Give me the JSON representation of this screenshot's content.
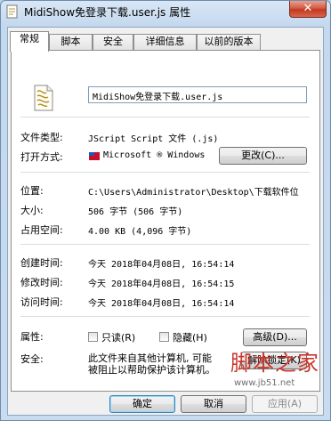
{
  "window": {
    "title": "MidiShow免登录下载.user.js 属性",
    "close_glyph": "✕"
  },
  "tabs": [
    {
      "label": "常规",
      "active": true
    },
    {
      "label": "脚本"
    },
    {
      "label": "安全"
    },
    {
      "label": "详细信息"
    },
    {
      "label": "以前的版本"
    }
  ],
  "general": {
    "filename": "MidiShow免登录下载.user.js",
    "file_type_label": "文件类型:",
    "file_type_value": "JScript Script 文件 (.js)",
    "open_with_label": "打开方式:",
    "open_with_value": "Microsoft ® Windows",
    "change_button": "更改(C)...",
    "location_label": "位置:",
    "location_value": "C:\\Users\\Administrator\\Desktop\\下载软件位",
    "size_label": "大小:",
    "size_value": "506 字节 (506 字节)",
    "size_on_disk_label": "占用空间:",
    "size_on_disk_value": "4.00 KB (4,096 字节)",
    "created_label": "创建时间:",
    "created_value": "今天 2018年04月08日, 16:54:14",
    "modified_label": "修改时间:",
    "modified_value": "今天 2018年04月08日, 16:54:15",
    "accessed_label": "访问时间:",
    "accessed_value": "今天 2018年04月08日, 16:54:14",
    "attributes_label": "属性:",
    "readonly_label": "只读(R)",
    "hidden_label": "隐藏(H)",
    "advanced_button": "高级(D)...",
    "security_label": "安全:",
    "security_text_line1": "此文件来自其他计算机, 可能",
    "security_text_line2": "被阻止以帮助保护该计算机。",
    "unblock_button": "解除锁定(K)"
  },
  "footer": {
    "ok_button": "确定",
    "cancel_button": "取消",
    "apply_button": "应用(A)"
  },
  "watermark": {
    "brand": "脚本之家",
    "url": "www.jb51.net"
  },
  "colors": {
    "close": "#c8432a",
    "watermark": "#c8372d",
    "title_bg": "#c4d8ee"
  }
}
